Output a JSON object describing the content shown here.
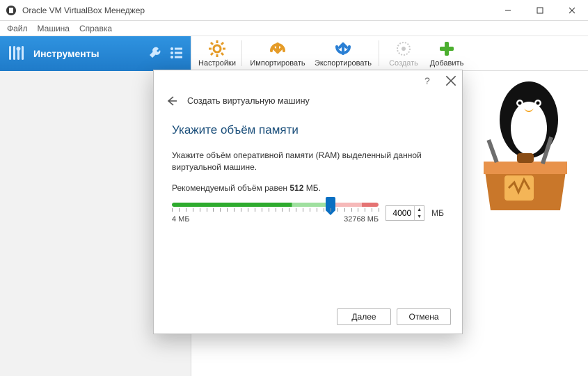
{
  "window": {
    "title": "Oracle VM VirtualBox Менеджер"
  },
  "menu": {
    "file": "Файл",
    "machine": "Машина",
    "help": "Справка"
  },
  "sidebar": {
    "instruments": "Инструменты"
  },
  "toolbar": {
    "settings": "Настройки",
    "import": "Импортировать",
    "export": "Экспортировать",
    "create": "Создать",
    "add": "Добавить"
  },
  "wizard": {
    "breadcrumb": "Создать виртуальную машину",
    "heading": "Укажите объём памяти",
    "p1": "Укажите объём оперативной памяти (RAM) выделенный данной виртуальной машине.",
    "p2_prefix": "Рекомендуемый объём равен ",
    "p2_value": "512",
    "p2_suffix": " МБ.",
    "min_label": "4 МБ",
    "max_label": "32768 МБ",
    "value": "4000",
    "unit": "МБ",
    "slider_min": 4,
    "slider_max": 32768,
    "next": "Далее",
    "cancel": "Отмена"
  }
}
